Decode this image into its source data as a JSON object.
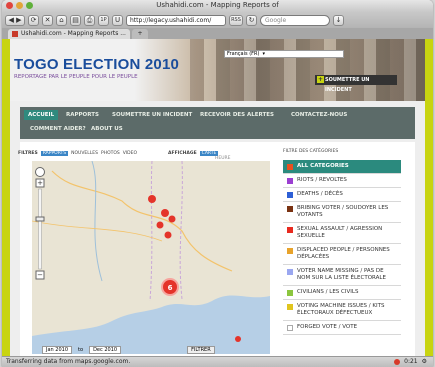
{
  "window": {
    "title": "Ushahidi.com - Mapping Reports of",
    "url": "http://legacy.ushahidi.com/",
    "search_placeholder": "Google",
    "tab_label": "Ushahidi.com - Mapping Reports ...",
    "toolbar_reader": "RSS"
  },
  "header": {
    "lang_label": "Français (FR)",
    "title": "TOGO ELECTION 2010",
    "subtitle": "REPORTAGE PAR LE PEUPLE POUR LE PEUPLE",
    "submit_label": "SOUMETTRE UN INCIDENT"
  },
  "nav": {
    "items": [
      {
        "label": "ACCUEIL",
        "active": true
      },
      {
        "label": "RAPPORTS"
      },
      {
        "label": "SOUMETTRE UN INCIDENT"
      },
      {
        "label": "RECEVOIR DES ALERTES"
      },
      {
        "label": "CONTACTEZ-NOUS"
      },
      {
        "label": "COMMENT AIDER?"
      },
      {
        "label": "ABOUT US"
      }
    ]
  },
  "filters": {
    "label": "FILTRES",
    "options": [
      "RAPPORTS",
      "NOUVELLES",
      "PHOTOS",
      "VIDEO"
    ],
    "display_label": "AFFICHAGE",
    "display_options": [
      "CARTE",
      "HEURE"
    ]
  },
  "map": {
    "cluster_count": "6",
    "time_from": "Jan 2010",
    "time_to": "Dec 2010",
    "filter_button": "FILTRER"
  },
  "sidebar": {
    "header": "FILTRE DES CATÉGORIES",
    "categories": [
      {
        "label": "ALL CATEGORIES",
        "color": "#e8501f",
        "active": true
      },
      {
        "label": "RIOTS / REVOLTES",
        "color": "#9b3fd1"
      },
      {
        "label": "DEATHS / DÉCÈS",
        "color": "#2d5fd6"
      },
      {
        "label": "BRIBING VOTER / SOUDOYER LES VOTANTS",
        "color": "#7a3212"
      },
      {
        "label": "SEXUAL ASSAULT / AGRESSION SEXUELLE",
        "color": "#e82a1f"
      },
      {
        "label": "DISPLACED PEOPLE / PERSONNES DÉPLACÉES",
        "color": "#e8a32b"
      },
      {
        "label": "VOTER NAME MISSING / PAS DE NOM SUR LA LISTE ÉLECTORALE",
        "color": "#9aa7f0"
      },
      {
        "label": "CIVILIANS / LES CIVILS",
        "color": "#8cc63f"
      },
      {
        "label": "VOTING MACHINE ISSUES / KITS ÉLECTORAUX DÉFECTUEUX",
        "color": "#e0c51f"
      },
      {
        "label": "FORGED VOTE / VOTE",
        "color": "#ffffff"
      }
    ]
  },
  "status": {
    "text": "Transferring data from maps.google.com.",
    "time": "0:21"
  }
}
